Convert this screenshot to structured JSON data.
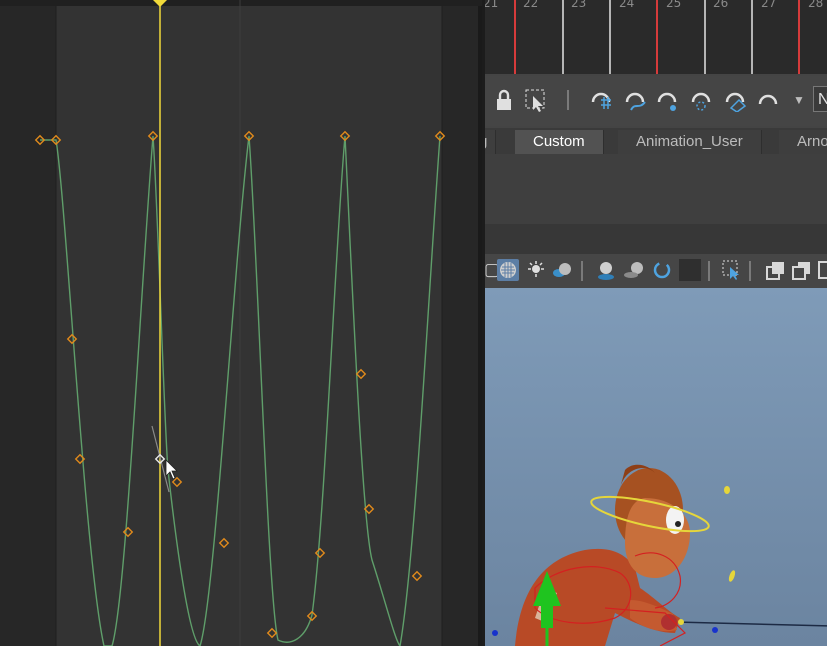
{
  "timeline": {
    "frames": [
      "21",
      "22",
      "23",
      "24",
      "25",
      "26",
      "27",
      "28"
    ]
  },
  "toolbar": {
    "icons": [
      "lock-icon",
      "select-icon",
      "separator",
      "snap-grid-icon",
      "snap-curve-icon",
      "snap-point-icon",
      "snap-projected-center-icon",
      "snap-view-plane-icon",
      "make-live-icon",
      "dropdown-arrow-icon"
    ],
    "overflow_label": "N"
  },
  "shelf": {
    "tabs": [
      "g",
      "Custom",
      "Animation_User",
      "Arno"
    ],
    "active_tab": "Custom"
  },
  "panel_toolbar": {
    "icons": [
      "wireframe-icon",
      "textured-icon",
      "lights-icon",
      "shadows-icon",
      "ambient-occlusion-icon",
      "motion-blur-icon",
      "anti-aliasing-icon",
      "isolate-select-icon",
      "xray-icon",
      "xray-joints-icon",
      "xray-active-icon"
    ]
  },
  "graph": {
    "curve_color": "#5f9e6a",
    "key_color": "#e08a1c",
    "current_time_color": "#f2da3a"
  }
}
